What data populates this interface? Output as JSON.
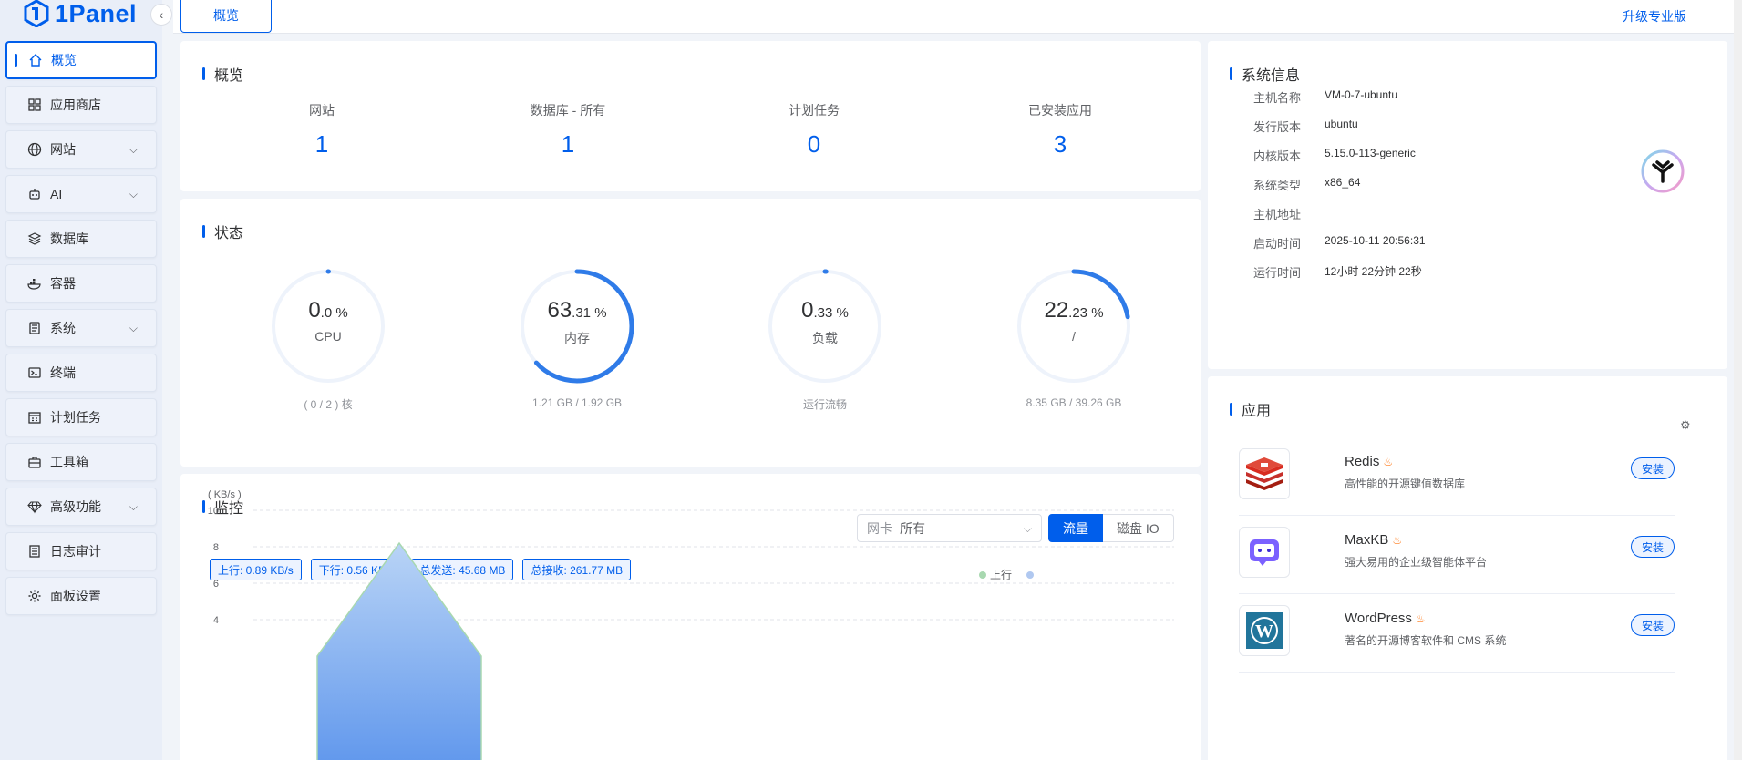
{
  "brand": {
    "name": "1Panel"
  },
  "sidebar": {
    "items": [
      {
        "label": "概览",
        "icon": "home-icon",
        "active": true,
        "chevron": false
      },
      {
        "label": "应用商店",
        "icon": "grid-icon",
        "active": false,
        "chevron": false
      },
      {
        "label": "网站",
        "icon": "globe-icon",
        "active": false,
        "chevron": true
      },
      {
        "label": "AI",
        "icon": "robot-icon",
        "active": false,
        "chevron": true
      },
      {
        "label": "数据库",
        "icon": "layers-icon",
        "active": false,
        "chevron": false
      },
      {
        "label": "容器",
        "icon": "docker-icon",
        "active": false,
        "chevron": false
      },
      {
        "label": "系统",
        "icon": "server-icon",
        "active": false,
        "chevron": true
      },
      {
        "label": "终端",
        "icon": "terminal-icon",
        "active": false,
        "chevron": false
      },
      {
        "label": "计划任务",
        "icon": "calendar-icon",
        "active": false,
        "chevron": false
      },
      {
        "label": "工具箱",
        "icon": "toolbox-icon",
        "active": false,
        "chevron": false
      },
      {
        "label": "高级功能",
        "icon": "diamond-icon",
        "active": false,
        "chevron": true
      },
      {
        "label": "日志审计",
        "icon": "log-icon",
        "active": false,
        "chevron": false
      },
      {
        "label": "面板设置",
        "icon": "gear-icon",
        "active": false,
        "chevron": false
      }
    ]
  },
  "topbar": {
    "tab_label": "概览",
    "upgrade_label": "升级专业版"
  },
  "overview": {
    "title": "概览",
    "items": [
      {
        "label": "网站",
        "value": "1"
      },
      {
        "label": "数据库 - 所有",
        "value": "1"
      },
      {
        "label": "计划任务",
        "value": "0"
      },
      {
        "label": "已安装应用",
        "value": "3"
      }
    ]
  },
  "status": {
    "title": "状态",
    "gauges": [
      {
        "int": "0",
        "dec": ".0 %",
        "name": "CPU",
        "sub": "( 0 / 2 ) 核",
        "percent": 0.0
      },
      {
        "int": "63",
        "dec": ".31 %",
        "name": "内存",
        "sub": "1.21 GB / 1.92 GB",
        "percent": 63.31
      },
      {
        "int": "0",
        "dec": ".33 %",
        "name": "负载",
        "sub": "运行流畅",
        "percent": 0.33
      },
      {
        "int": "22",
        "dec": ".23 %",
        "name": "/",
        "sub": "8.35 GB / 39.26 GB",
        "percent": 22.23
      }
    ]
  },
  "monitor": {
    "title": "监控",
    "netcard_label": "网卡",
    "netcard_value": "所有",
    "btn_traffic": "流量",
    "btn_disk": "磁盘 IO",
    "tags": [
      "上行: 0.89 KB/s",
      "下行: 0.56 KB/s",
      "总发送: 45.68 MB",
      "总接收: 261.77 MB"
    ],
    "legend_up": "上行"
  },
  "chart_data": {
    "type": "area",
    "ylabel": "( KB/s )",
    "ylim": [
      4,
      10
    ],
    "yticks": [
      "10",
      "8",
      "6",
      "4"
    ],
    "series": [
      {
        "name": "上行",
        "x": [
          0,
          1,
          2
        ],
        "values": [
          2,
          8.2,
          2
        ]
      }
    ]
  },
  "sysinfo": {
    "title": "系统信息",
    "rows": [
      {
        "key": "主机名称",
        "value": "VM-0-7-ubuntu"
      },
      {
        "key": "发行版本",
        "value": "ubuntu"
      },
      {
        "key": "内核版本",
        "value": "5.15.0-113-generic"
      },
      {
        "key": "系统类型",
        "value": "x86_64"
      },
      {
        "key": "主机地址",
        "value": ""
      },
      {
        "key": "启动时间",
        "value": "2025-10-11 20:56:31"
      },
      {
        "key": "运行时间",
        "value": "12小时 22分钟 22秒"
      }
    ]
  },
  "apps": {
    "title": "应用",
    "items": [
      {
        "name": "Redis",
        "desc": "高性能的开源键值数据库",
        "button": "安装",
        "icon": "redis-icon"
      },
      {
        "name": "MaxKB",
        "desc": "强大易用的企业级智能体平台",
        "button": "安装",
        "icon": "maxkb-icon"
      },
      {
        "name": "WordPress",
        "desc": "著名的开源博客软件和 CMS 系统",
        "button": "安装",
        "icon": "wordpress-icon"
      }
    ]
  },
  "colors": {
    "accent": "#005eeb",
    "gauge_track": "#eef3fb",
    "gauge_fill": "#2f7be8"
  }
}
